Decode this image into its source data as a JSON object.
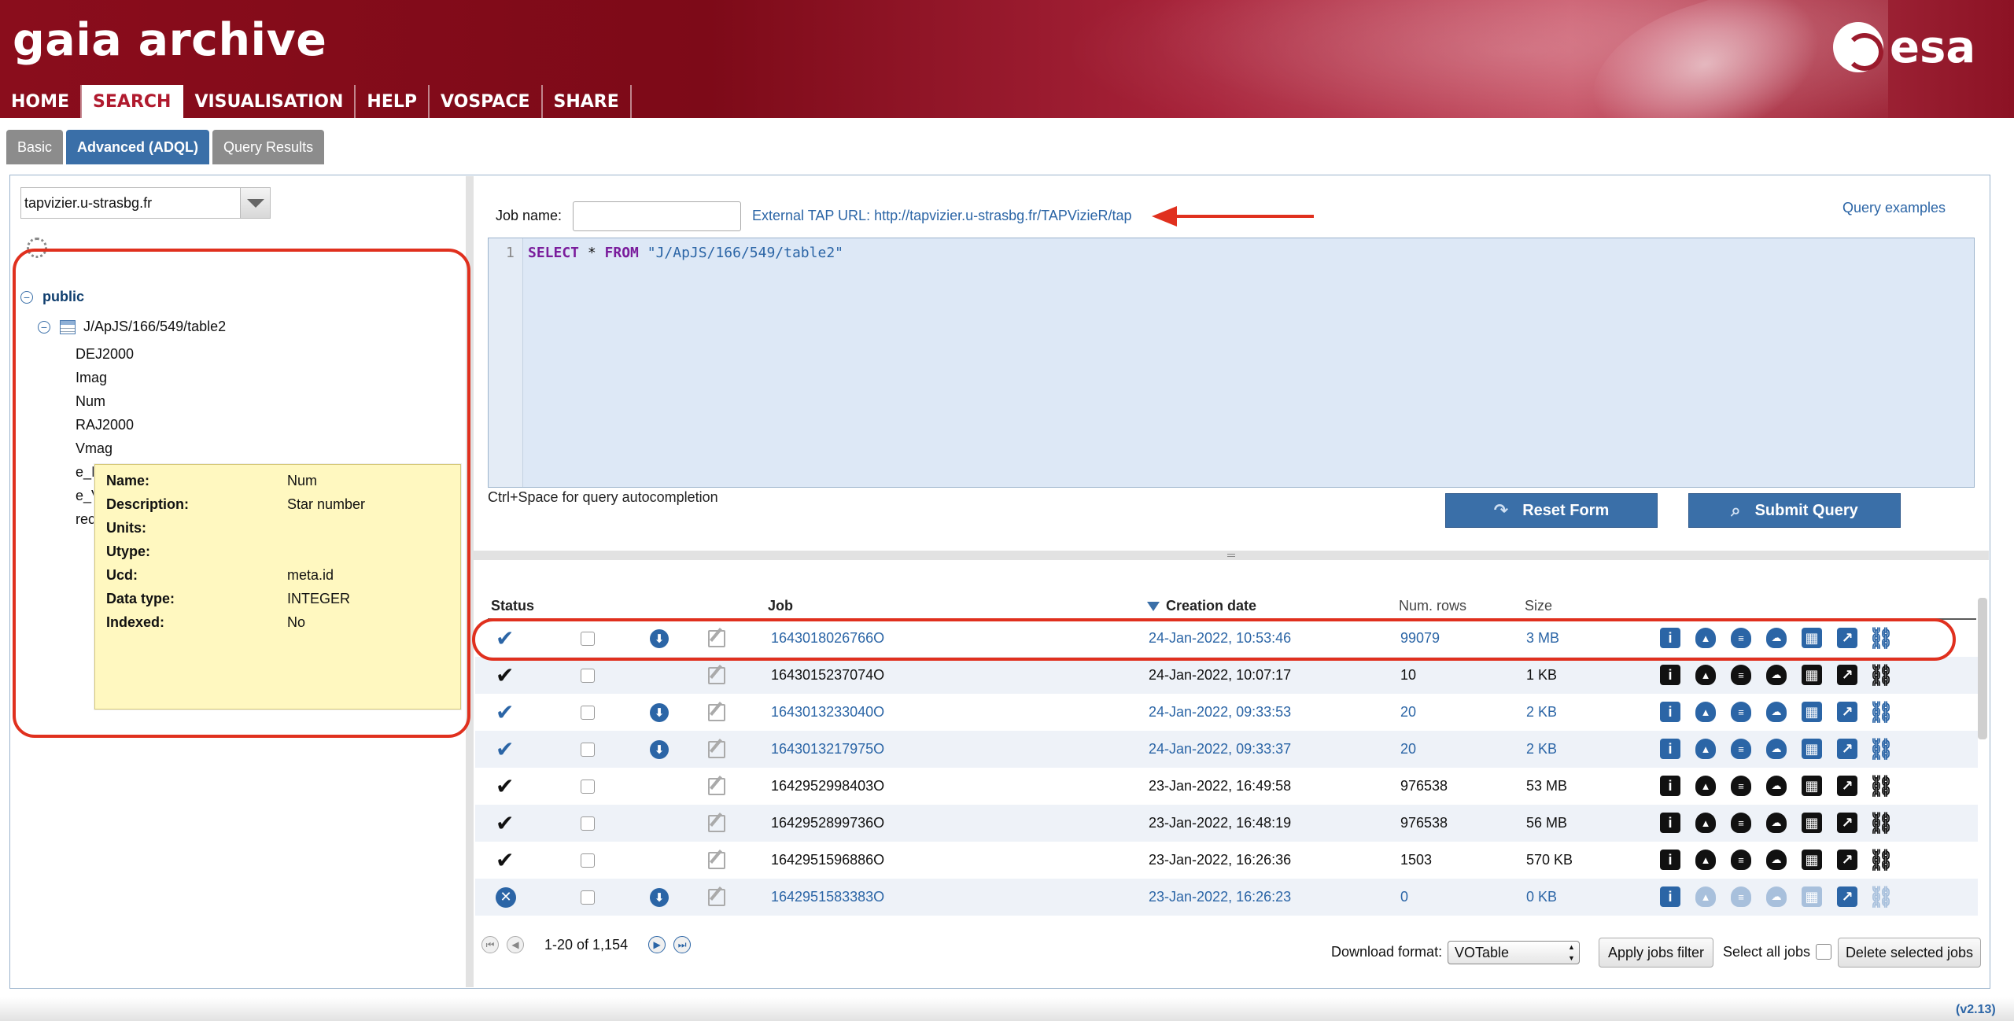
{
  "header": {
    "title": "gaia archive",
    "logo_text": "esa",
    "nav": [
      "HOME",
      "SEARCH",
      "VISUALISATION",
      "HELP",
      "VOSPACE",
      "SHARE"
    ]
  },
  "subtabs": [
    "Basic",
    "Advanced (ADQL)",
    "Query Results"
  ],
  "left": {
    "service": "tapvizier.u-strasbg.fr",
    "schema": "public",
    "table": "J/ApJS/166/549/table2",
    "columns": [
      "DEJ2000",
      "Imag",
      "Num",
      "RAJ2000",
      "Vmag",
      "e_I",
      "e_V",
      "rec"
    ],
    "tooltip": {
      "rows": [
        {
          "k": "Name:",
          "v": "Num"
        },
        {
          "k": "Description:",
          "v": "Star number"
        },
        {
          "k": "Units:",
          "v": ""
        },
        {
          "k": "Utype:",
          "v": ""
        },
        {
          "k": "Ucd:",
          "v": "meta.id"
        },
        {
          "k": "Data type:",
          "v": "INTEGER"
        },
        {
          "k": "Indexed:",
          "v": "No"
        }
      ]
    }
  },
  "query": {
    "job_name_label": "Job name:",
    "job_name_value": "",
    "tap_url": "External TAP URL: http://tapvizier.u-strasbg.fr/TAPVizieR/tap",
    "examples_link": "Query examples",
    "line_number": "1",
    "kw_select": "SELECT",
    "star": " * ",
    "kw_from": "FROM",
    "table_literal": " \"J/ApJS/166/549/table2\"",
    "hint": "Ctrl+Space for query autocompletion",
    "reset_label": "Reset Form",
    "submit_label": "Submit Query"
  },
  "jobs": {
    "headers": {
      "status": "Status",
      "job": "Job",
      "creation": "Creation date",
      "rows": "Num. rows",
      "size": "Size"
    },
    "rows": [
      {
        "status": "ok-blue",
        "dl": true,
        "job": "1643018026766O",
        "date": "24-Jan-2022, 10:53:46",
        "rows": "99079",
        "size": "3 MB",
        "style": "blue"
      },
      {
        "status": "ok-black",
        "dl": false,
        "job": "1643015237074O",
        "date": "24-Jan-2022, 10:07:17",
        "rows": "10",
        "size": "1 KB",
        "style": "black"
      },
      {
        "status": "ok-blue",
        "dl": true,
        "job": "1643013233040O",
        "date": "24-Jan-2022, 09:33:53",
        "rows": "20",
        "size": "2 KB",
        "style": "blue"
      },
      {
        "status": "ok-blue",
        "dl": true,
        "job": "1643013217975O",
        "date": "24-Jan-2022, 09:33:37",
        "rows": "20",
        "size": "2 KB",
        "style": "blue"
      },
      {
        "status": "ok-black",
        "dl": false,
        "job": "1642952998403O",
        "date": "23-Jan-2022, 16:49:58",
        "rows": "976538",
        "size": "53 MB",
        "style": "black"
      },
      {
        "status": "ok-black",
        "dl": false,
        "job": "1642952899736O",
        "date": "23-Jan-2022, 16:48:19",
        "rows": "976538",
        "size": "56 MB",
        "style": "black"
      },
      {
        "status": "ok-black",
        "dl": false,
        "job": "1642951596886O",
        "date": "23-Jan-2022, 16:26:36",
        "rows": "1503",
        "size": "570 KB",
        "style": "black"
      },
      {
        "status": "error",
        "dl": true,
        "job": "1642951583383O",
        "date": "23-Jan-2022, 16:26:23",
        "rows": "0",
        "size": "0 KB",
        "style": "faded"
      }
    ],
    "pager_text": "1-20 of 1,154",
    "download_format_label": "Download format:",
    "download_format_value": "VOTable",
    "apply_filter_label": "Apply jobs filter",
    "select_all_label": "Select all jobs",
    "delete_label": "Delete selected jobs"
  },
  "version": "(v2.13)",
  "colors": {
    "header": "#8a0d1c",
    "accent": "#3a6fa8",
    "link": "#2b65a6",
    "annotation": "#e0301e"
  }
}
